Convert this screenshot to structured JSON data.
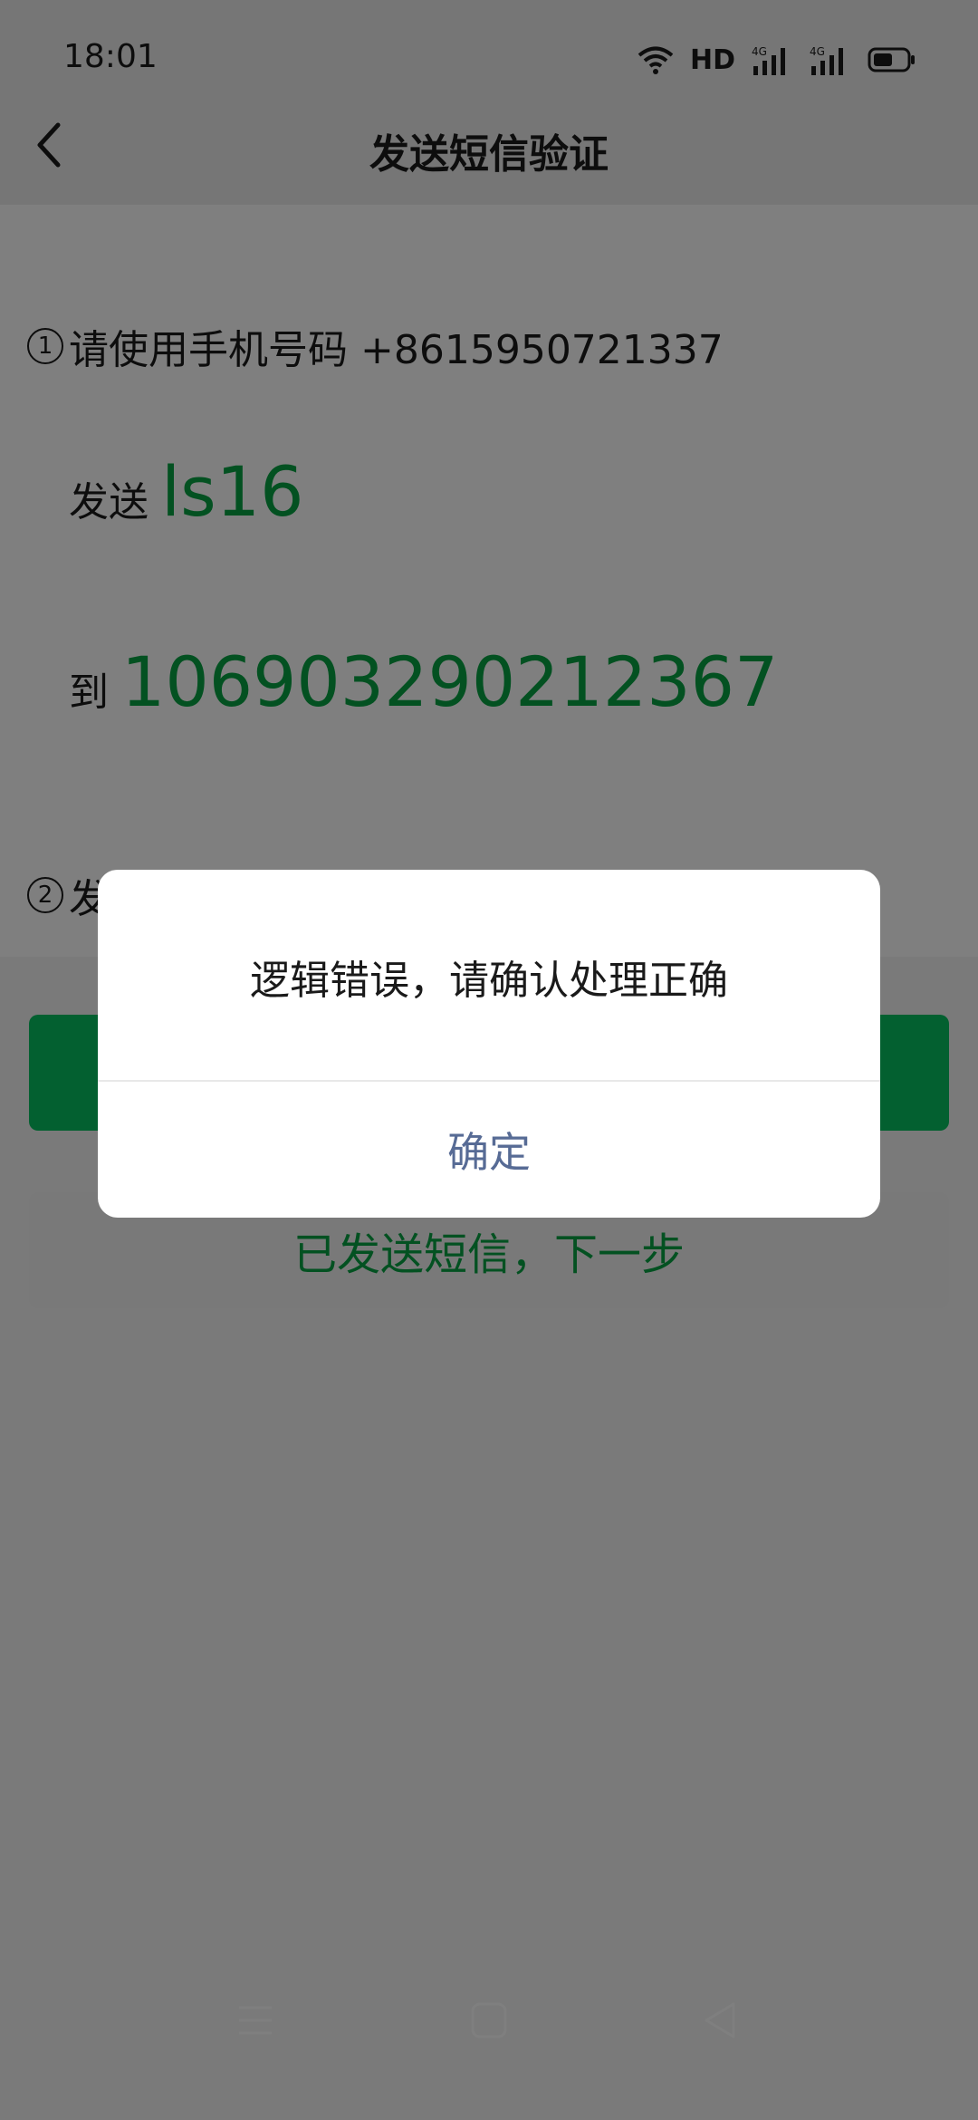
{
  "status_bar": {
    "time": "18:01",
    "hd_label": "HD"
  },
  "nav": {
    "title": "发送短信验证"
  },
  "steps": {
    "step1": {
      "num": "1",
      "text": "请使用手机号码 +8615950721337"
    },
    "send_prefix": "发送",
    "send_code": "ls16",
    "to_prefix": "到",
    "to_number": "106903290212367",
    "step2": {
      "num": "2",
      "text": "发"
    }
  },
  "buttons": {
    "primary_label": "",
    "secondary_label": "已发送短信，下一步"
  },
  "dialog": {
    "message": "逻辑错误，请确认处理正确",
    "confirm_label": "确定"
  },
  "colors": {
    "accent": "#07c160",
    "accent_text": "#07a243",
    "dialog_link": "#576b95"
  }
}
